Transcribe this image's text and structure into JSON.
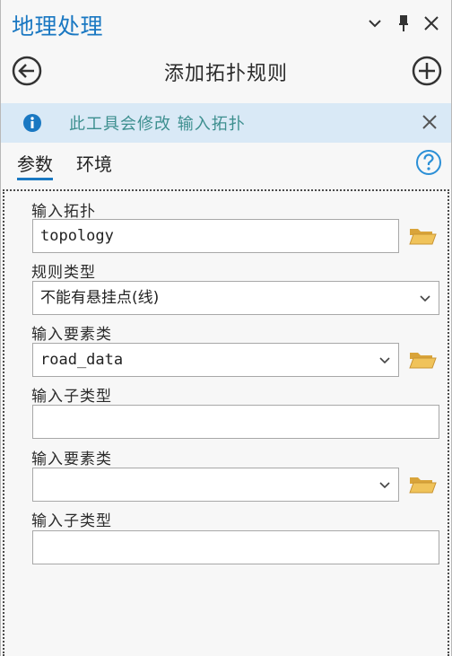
{
  "window": {
    "title": "地理处理",
    "menu_icon": "chevron-down-icon",
    "pin_icon": "pin-icon",
    "close_icon": "close-icon"
  },
  "header": {
    "tool_title": "添加拓扑规则",
    "back_icon": "back-arrow-icon",
    "add_icon": "plus-icon"
  },
  "banner": {
    "text": "此工具会修改 输入拓扑",
    "info_icon": "info-icon",
    "close_icon": "close-icon"
  },
  "tabs": [
    {
      "label": "参数",
      "active": true
    },
    {
      "label": "环境",
      "active": false
    }
  ],
  "help_icon": "help-icon",
  "params": [
    {
      "label": "输入拓扑",
      "value": "topology",
      "type": "text",
      "browse": true
    },
    {
      "label": "规则类型",
      "value": "不能有悬挂点(线)",
      "type": "select",
      "browse": false
    },
    {
      "label": "输入要素类",
      "value": "road_data",
      "type": "select",
      "browse": true
    },
    {
      "label": "输入子类型",
      "value": "",
      "type": "text",
      "browse": false
    },
    {
      "label": "输入要素类",
      "value": "",
      "type": "select",
      "browse": true
    },
    {
      "label": "输入子类型",
      "value": "",
      "type": "text",
      "browse": false
    }
  ],
  "colors": {
    "accent": "#1a78c2",
    "banner_bg": "#d9e9f6",
    "banner_text": "#3d8f8f",
    "folder": "#e8b64a"
  }
}
